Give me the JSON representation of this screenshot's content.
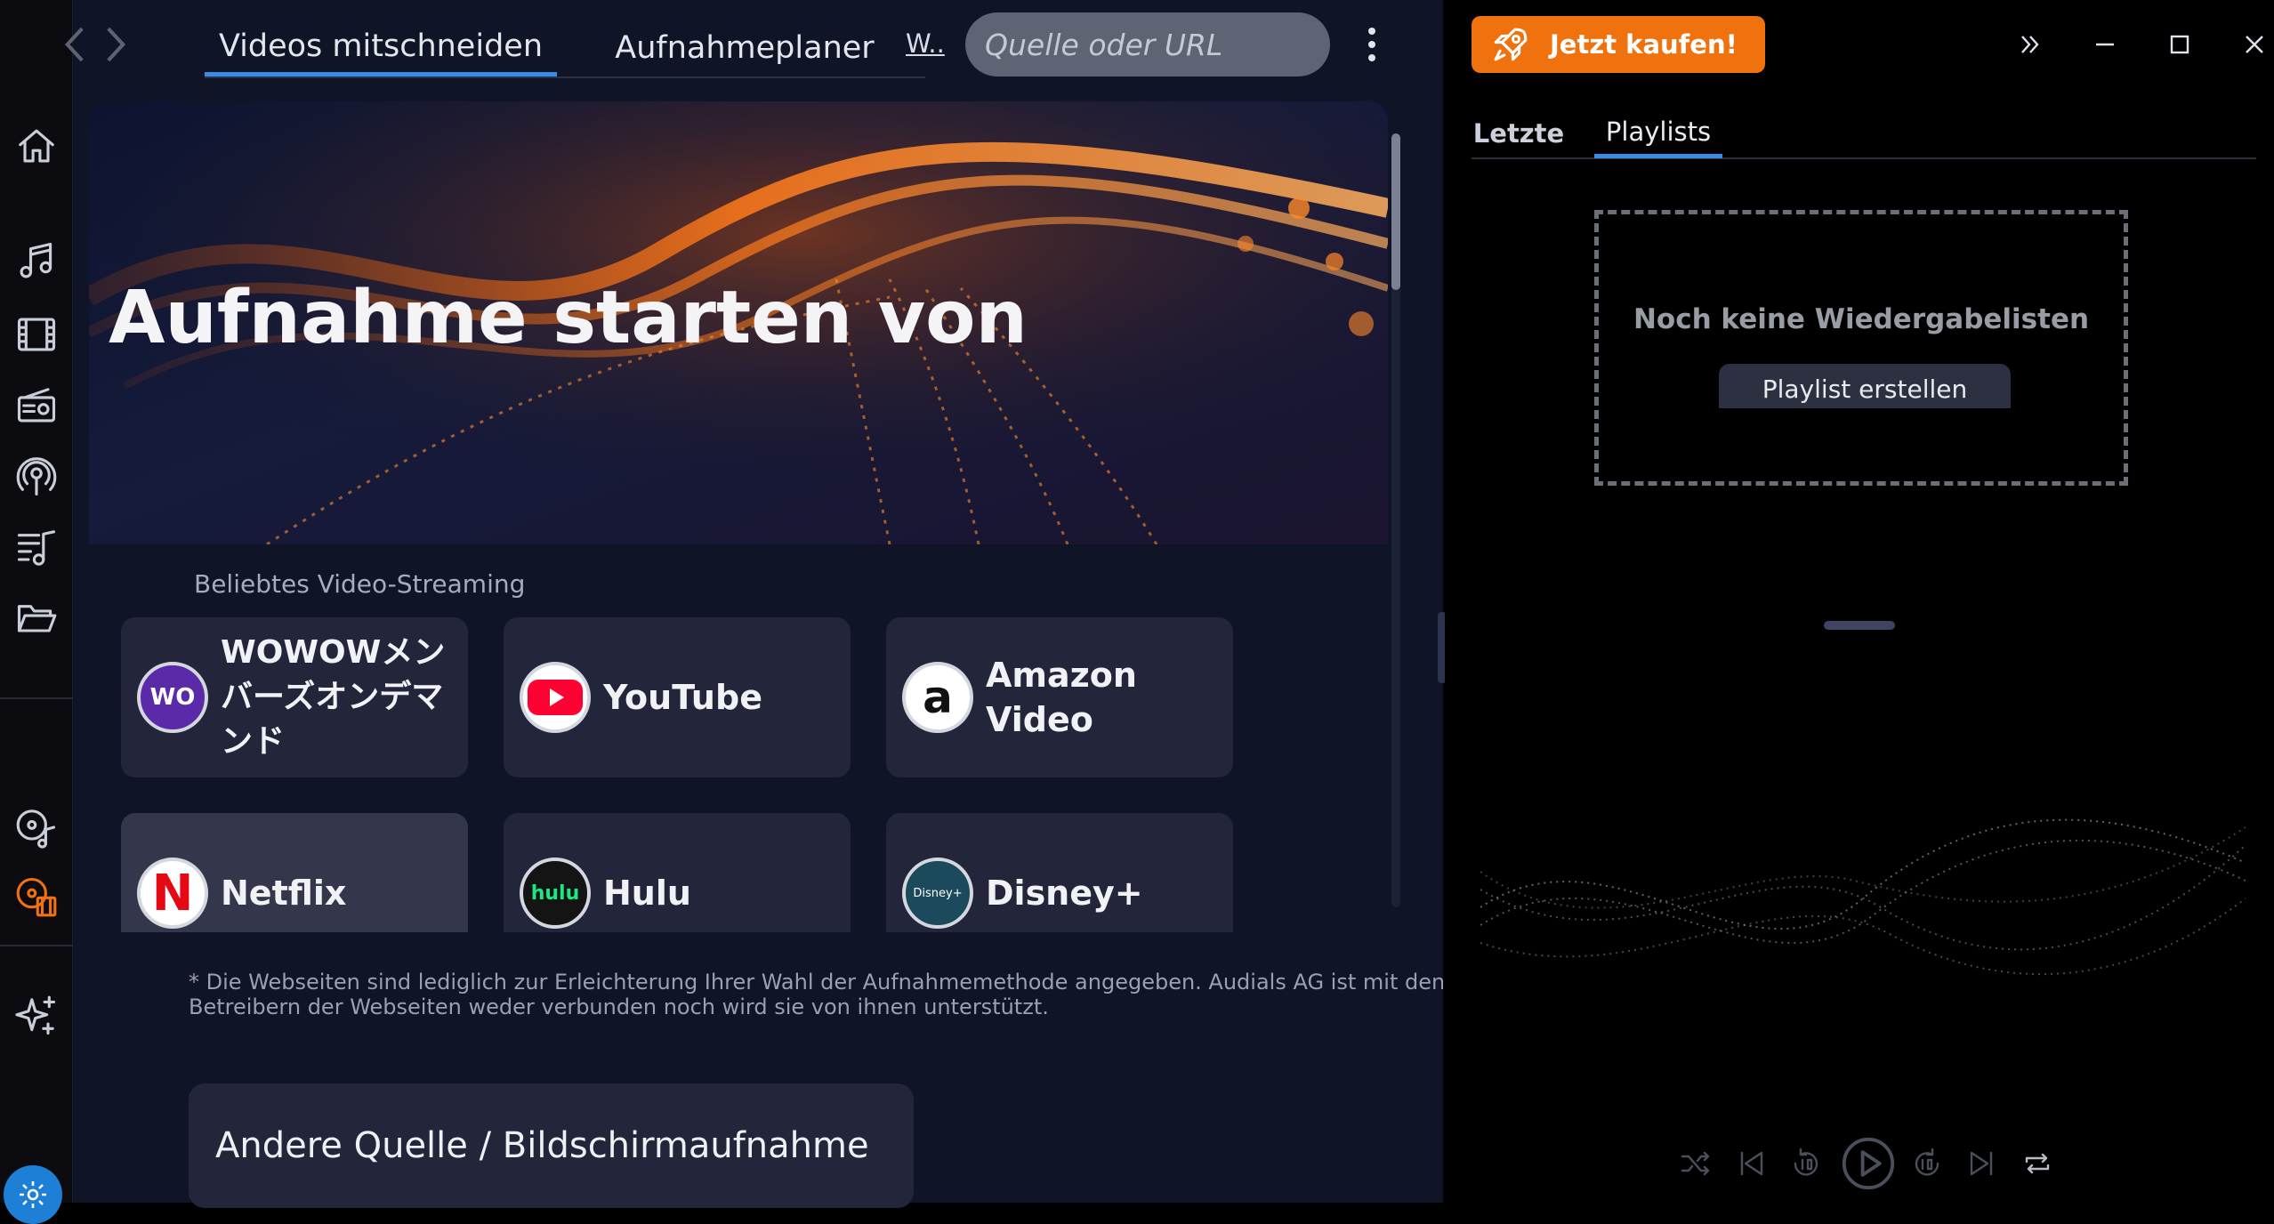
{
  "nav": {
    "tabs": [
      {
        "label": "Videos mitschneiden",
        "active": true
      },
      {
        "label": "Aufnahmeplaner",
        "active": false
      }
    ],
    "short_link": "W..",
    "search_placeholder": "Quelle oder URL"
  },
  "hero": {
    "title": "Aufnahme starten von"
  },
  "streaming": {
    "section_label": "Beliebtes Video-Streaming",
    "services": [
      {
        "name": "WOWOWメンバーズオンデマンド",
        "logo_text": "WO",
        "logo_color": "#5a2aa8"
      },
      {
        "name": "YouTube",
        "logo_text": "",
        "logo_color": "#ff0033"
      },
      {
        "name": "Amazon Video",
        "logo_text": "a",
        "logo_color": "#ffffff"
      },
      {
        "name": "Netflix",
        "logo_text": "N",
        "logo_color": "#ffffff"
      },
      {
        "name": "Hulu",
        "logo_text": "hulu",
        "logo_color": "#141414"
      },
      {
        "name": "Disney+",
        "logo_text": "Disney+",
        "logo_color": "#1b4a5c"
      }
    ]
  },
  "disclaimer": "* Die Webseiten sind lediglich zur Erleichterung Ihrer Wahl der Aufnahmemethode angegeben. Audials AG ist mit den Betreibern der Webseiten weder verbunden noch wird sie von ihnen unterstützt.",
  "other_source_label": "Andere Quelle / Bildschirmaufnahme",
  "right_panel": {
    "buy_label": "Jetzt kaufen!",
    "tabs": [
      {
        "label": "Letzte",
        "active": false
      },
      {
        "label": "Playlists",
        "active": true
      }
    ],
    "empty_title": "Noch keine Wiedergabelisten",
    "create_label": "Playlist erstellen"
  },
  "colors": {
    "accent": "#3b8ae8",
    "buy": "#f0720f",
    "active_rail": "#f0720f",
    "settings": "#1e7fd6"
  },
  "rail_icons": [
    "home-icon",
    "music-icon",
    "film-icon",
    "radio-icon",
    "podcast-icon",
    "playlist-music-icon",
    "folder-icon",
    "music-recorder-icon",
    "video-recorder-icon",
    "sparkle-icon",
    "settings-icon"
  ],
  "player_icons": [
    "shuffle-icon",
    "previous-icon",
    "rewind-10-icon",
    "play-icon",
    "forward-10-icon",
    "next-icon",
    "repeat-icon"
  ]
}
